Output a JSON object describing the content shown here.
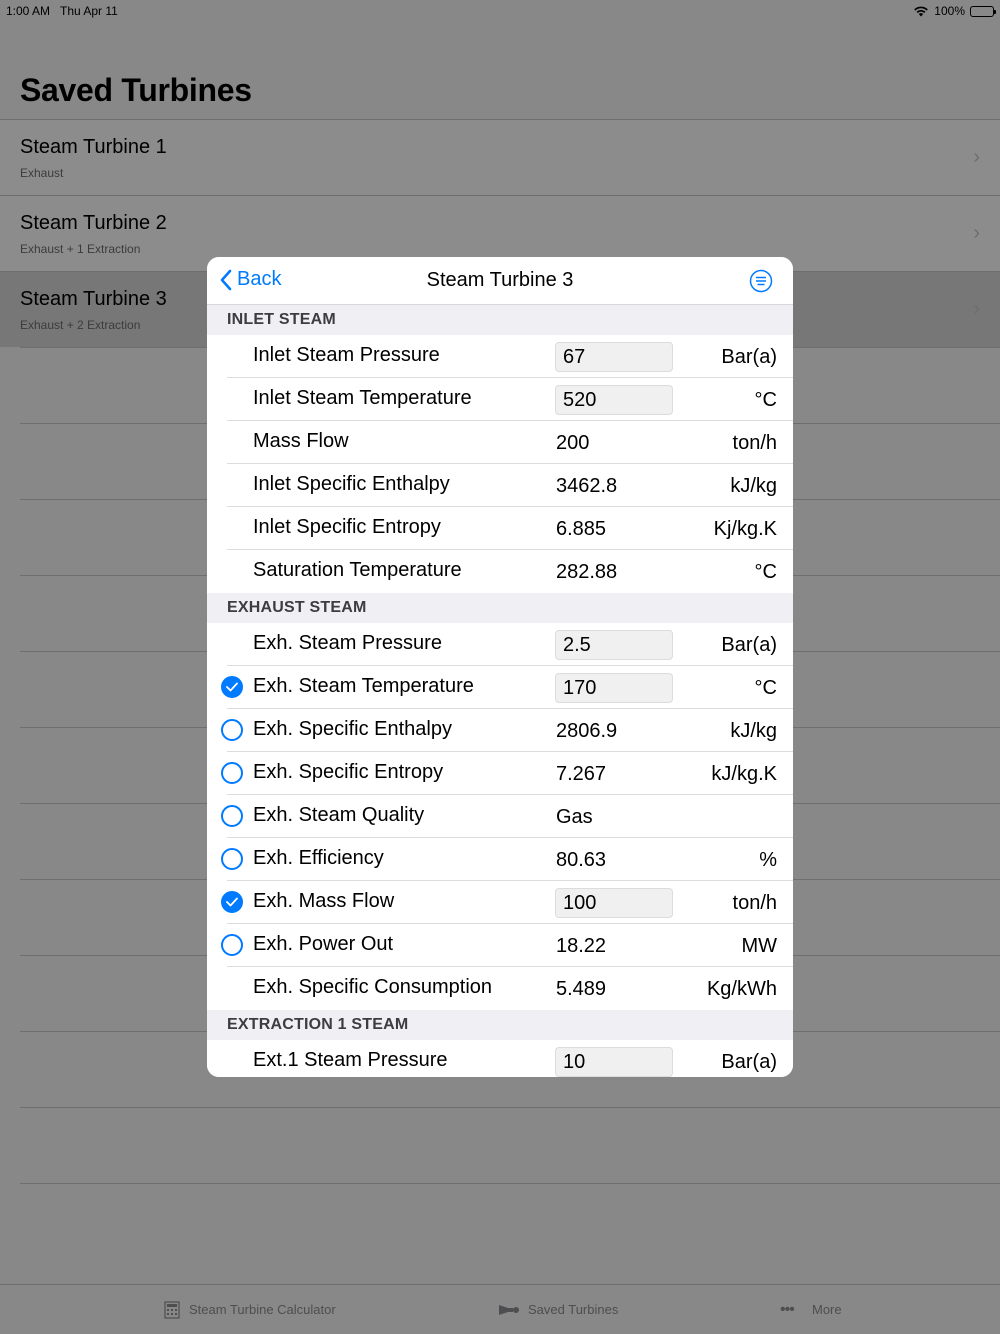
{
  "status_bar": {
    "time": "1:00 AM",
    "date": "Thu Apr 11",
    "battery": "100%"
  },
  "page": {
    "title": "Saved Turbines"
  },
  "saved_list": [
    {
      "title": "Steam Turbine 1",
      "subtitle": "Exhaust"
    },
    {
      "title": "Steam Turbine 2",
      "subtitle": "Exhaust + 1 Extraction"
    },
    {
      "title": "Steam Turbine 3",
      "subtitle": "Exhaust + 2 Extraction"
    }
  ],
  "tab_bar": {
    "calculator": "Steam Turbine Calculator",
    "saved": "Saved Turbines",
    "more": "More"
  },
  "modal": {
    "back_label": "Back",
    "title": "Steam Turbine 3",
    "sections": {
      "inlet": {
        "header": "INLET STEAM",
        "rows": [
          {
            "label": "Inlet Steam Pressure",
            "value": "67",
            "unit": "Bar(a)"
          },
          {
            "label": "Inlet Steam Temperature",
            "value": "520",
            "unit": "°C"
          },
          {
            "label": "Mass Flow",
            "value": "200",
            "unit": "ton/h"
          },
          {
            "label": "Inlet Specific Enthalpy",
            "value": "3462.8",
            "unit": "kJ/kg"
          },
          {
            "label": "Inlet Specific Entropy",
            "value": "6.885",
            "unit": "Kj/kg.K"
          },
          {
            "label": "Saturation Temperature",
            "value": "282.88",
            "unit": "°C"
          }
        ]
      },
      "exhaust": {
        "header": "EXHAUST STEAM",
        "rows": [
          {
            "label": "Exh. Steam Pressure",
            "value": "2.5",
            "unit": "Bar(a)"
          },
          {
            "label": "Exh. Steam Temperature",
            "value": "170",
            "unit": "°C"
          },
          {
            "label": "Exh. Specific Enthalpy",
            "value": "2806.9",
            "unit": "kJ/kg"
          },
          {
            "label": "Exh. Specific Entropy",
            "value": "7.267",
            "unit": "kJ/kg.K"
          },
          {
            "label": "Exh. Steam Quality",
            "value": "Gas",
            "unit": ""
          },
          {
            "label": "Exh. Efficiency",
            "value": "80.63",
            "unit": "%"
          },
          {
            "label": "Exh. Mass Flow",
            "value": "100",
            "unit": "ton/h"
          },
          {
            "label": "Exh. Power Out",
            "value": "18.22",
            "unit": "MW"
          },
          {
            "label": "Exh. Specific Consumption",
            "value": "5.489",
            "unit": "Kg/kWh"
          }
        ]
      },
      "extraction1": {
        "header": "EXTRACTION 1 STEAM",
        "rows": [
          {
            "label": "Ext.1 Steam Pressure",
            "value": "10",
            "unit": "Bar(a)"
          }
        ]
      }
    }
  }
}
